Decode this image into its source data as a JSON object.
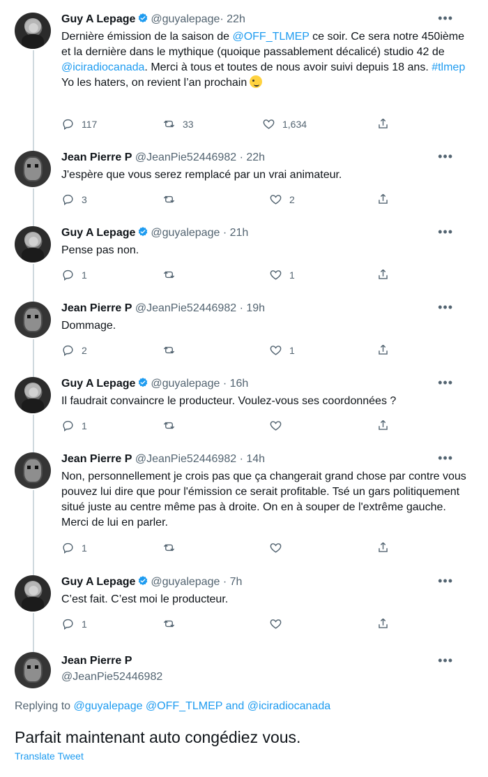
{
  "accent": "#1d9bf0",
  "icons": [
    "verified-badge-icon",
    "more-options-icon",
    "reply-icon",
    "retweet-icon",
    "like-icon",
    "share-icon"
  ],
  "tweets": [
    {
      "name": "Guy A Lepage",
      "handle": "@guyalepage",
      "time": "· 22h",
      "text_parts": [
        "Dernière émission de la saison de ",
        "@OFF_TLMEP",
        " ce soir. Ce sera notre 450ième et la dernière dans le mythique (quoique passablement décalicé) studio 42 de ",
        "@iciradiocanada",
        ". Merci à tous et toutes de nous avoir suivi depuis 18 ans. ",
        "#tlmep",
        "Yo les haters, on revient l’an prochain"
      ],
      "replies": "117",
      "retweets": "33",
      "likes": "1,634"
    },
    {
      "name": "Jean Pierre P",
      "handle": "@JeanPie52446982",
      "time": "· 22h",
      "text": "J'espère que vous serez remplacé par un vrai animateur.",
      "replies": "3",
      "retweets": "",
      "likes": "2"
    },
    {
      "name": "Guy A Lepage",
      "handle": "@guyalepage",
      "time": "· 21h",
      "text": "Pense pas non.",
      "replies": "1",
      "retweets": "",
      "likes": "1"
    },
    {
      "name": "Jean Pierre P",
      "handle": "@JeanPie52446982",
      "time": "· 19h",
      "text": "Dommage.",
      "replies": "2",
      "retweets": "",
      "likes": "1"
    },
    {
      "name": "Guy A Lepage",
      "handle": "@guyalepage",
      "time": "· 16h",
      "text": "Il faudrait convaincre le producteur. Voulez-vous ses coordonnées ?",
      "replies": "1",
      "retweets": "",
      "likes": ""
    },
    {
      "name": "Jean Pierre P",
      "handle": "@JeanPie52446982",
      "time": "· 14h",
      "text": "Non, personnellement je crois pas que ça changerait grand chose par contre vous pouvez lui dire que pour l'émission ce serait profitable. Tsé un gars politiquement situé juste au centre même pas à droite. On en à souper de l'extrême gauche. Merci de lui en parler.",
      "replies": "1",
      "retweets": "",
      "likes": ""
    },
    {
      "name": "Guy A Lepage",
      "handle": "@guyalepage",
      "time": "· 7h",
      "text": "C’est fait. C’est moi le producteur.",
      "replies": "1",
      "retweets": "",
      "likes": ""
    }
  ],
  "final": {
    "name": "Jean Pierre P",
    "handle": "@JeanPie52446982",
    "replying_prefix": "Replying to",
    "replying_to": "@guyalepage @OFF_TLMEP and @iciradiocanada",
    "text": "Parfait maintenant auto congédiez vous.",
    "translate": "Translate Tweet"
  }
}
